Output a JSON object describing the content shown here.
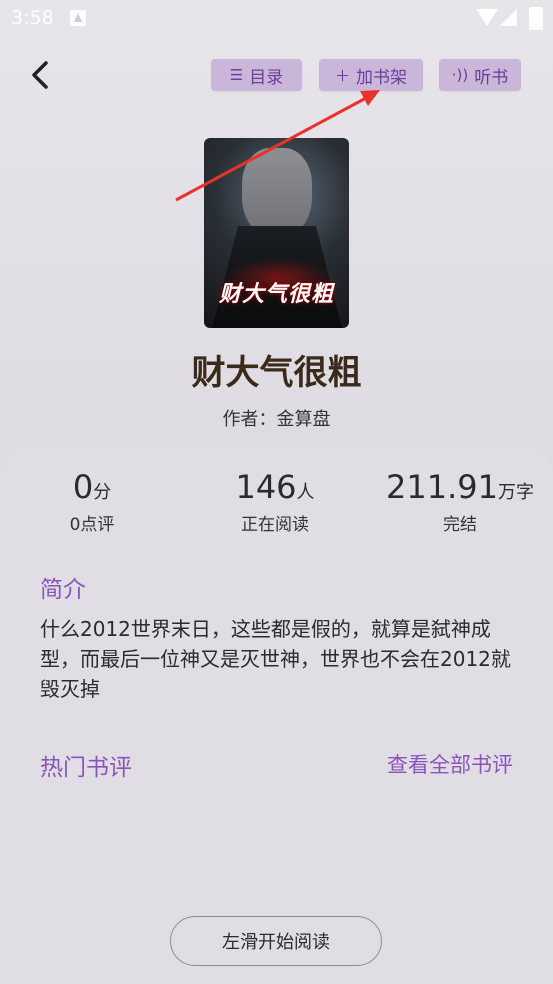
{
  "status_bar": {
    "time": "3:58"
  },
  "toolbar": {
    "catalog_label": "目录",
    "add_shelf_label": "加书架",
    "listen_label": "听书"
  },
  "book": {
    "cover_title": "财大气很粗",
    "title": "财大气很粗",
    "author_line": "作者：金算盘"
  },
  "stats": [
    {
      "value": "0",
      "unit": "分",
      "label": "0点评"
    },
    {
      "value": "146",
      "unit": "人",
      "label": "正在阅读"
    },
    {
      "value": "211.91",
      "unit": "万字",
      "label": "完结"
    }
  ],
  "intro": {
    "heading": "简介",
    "text": "什么2012世界末日，这些都是假的，就算是弑神成型，而最后一位神又是灭世神，世界也不会在2012就毁灭掉"
  },
  "reviews": {
    "heading": "热门书评",
    "view_all": "查看全部书评"
  },
  "start_button": "左滑开始阅读",
  "colors": {
    "accent": "#8a55b8",
    "pill_bg": "#c9b6d9",
    "arrow": "#e8322a"
  }
}
